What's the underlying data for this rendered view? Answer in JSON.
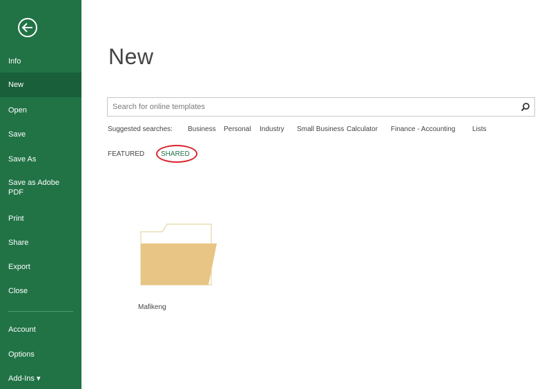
{
  "sidebar": {
    "items": [
      {
        "label": "Info"
      },
      {
        "label": "New"
      },
      {
        "label": "Open"
      },
      {
        "label": "Save"
      },
      {
        "label": "Save As"
      },
      {
        "label": "Save as Adobe PDF"
      },
      {
        "label": "Print"
      },
      {
        "label": "Share"
      },
      {
        "label": "Export"
      },
      {
        "label": "Close"
      },
      {
        "label": "Account"
      },
      {
        "label": "Options"
      },
      {
        "label": "Add-Ins ▾"
      }
    ],
    "active_item": "New",
    "back_icon": "back-arrow-icon"
  },
  "main": {
    "title": "New",
    "search": {
      "placeholder": "Search for online templates",
      "value": "",
      "icon": "search-icon"
    },
    "suggested": {
      "label": "Suggested searches:",
      "links": [
        "Business",
        "Personal",
        "Industry",
        "Small Business",
        "Calculator",
        "Finance - Accounting",
        "Lists"
      ]
    },
    "tabs": [
      {
        "label": "FEATURED"
      },
      {
        "label": "SHARED"
      }
    ],
    "selected_tab": "SHARED",
    "templates": [
      {
        "label": "Mafikeng",
        "icon": "folder-icon"
      }
    ]
  },
  "colors": {
    "sidebar": "#217346",
    "sidebar_active": "#19603a",
    "accent": "#217346",
    "highlight_circle": "#d8232a",
    "folder": "#e8c585"
  }
}
